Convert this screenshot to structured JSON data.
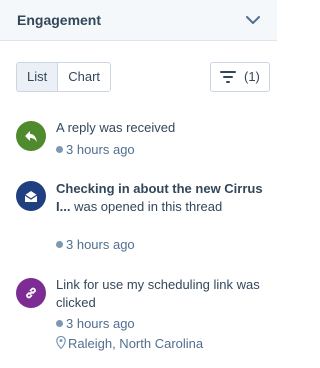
{
  "header": {
    "title": "Engagement"
  },
  "view_toggle": {
    "list_label": "List",
    "chart_label": "Chart",
    "active": "List"
  },
  "filter": {
    "count_label": "(1)"
  },
  "colors": {
    "reply": "#4f8a2f",
    "email": "#1f3f80",
    "link": "#7d2c93"
  },
  "items": [
    {
      "icon": "reply-arrow-icon",
      "text": "A reply was received",
      "time": "3 hours ago"
    },
    {
      "icon": "envelope-open-icon",
      "title": "Checking in about the new Cirrus I...",
      "text": "was opened in this thread",
      "time": "3 hours ago"
    },
    {
      "icon": "link-icon",
      "text": "Link for use my scheduling link was clicked",
      "time": "3 hours ago",
      "location": "Raleigh, North Carolina"
    }
  ]
}
